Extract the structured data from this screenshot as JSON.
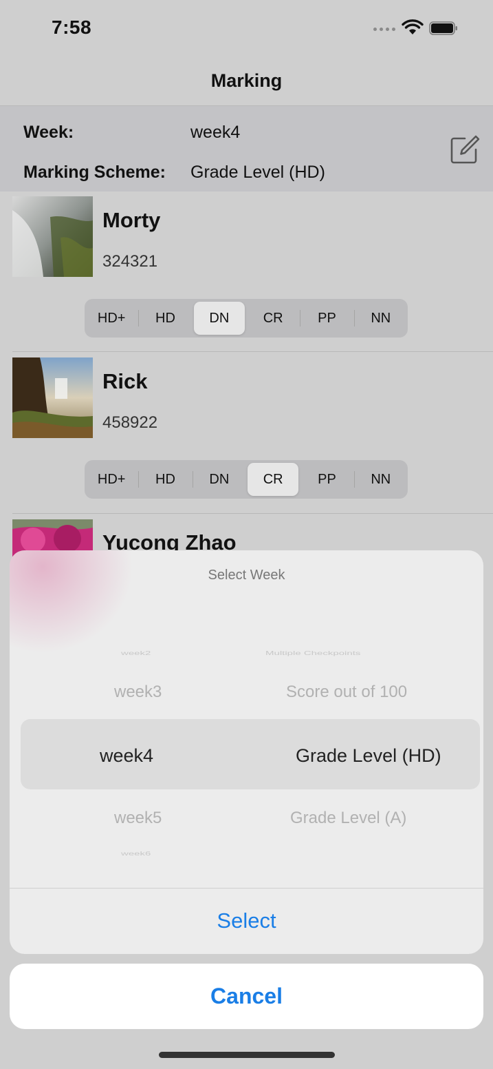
{
  "status_bar": {
    "time": "7:58"
  },
  "nav": {
    "title": "Marking"
  },
  "info": {
    "week_label": "Week:",
    "week_value": "week4",
    "scheme_label": "Marking Scheme:",
    "scheme_value": "Grade Level (HD)"
  },
  "grade_options": [
    "HD+",
    "HD",
    "DN",
    "CR",
    "PP",
    "NN"
  ],
  "students": [
    {
      "name": "Morty",
      "id": "324321",
      "selected_grade": "DN"
    },
    {
      "name": "Rick",
      "id": "458922",
      "selected_grade": "CR"
    },
    {
      "name": "Yucong Zhao"
    }
  ],
  "sheet": {
    "title": "Select Week",
    "weeks": [
      "week2",
      "week3",
      "week4",
      "week5",
      "week6"
    ],
    "schemes": [
      "Multiple Checkpoints",
      "Score out of 100",
      "Grade Level (HD)",
      "Grade Level (A)"
    ],
    "selected_week": "week4",
    "selected_scheme": "Grade Level (HD)",
    "select_label": "Select",
    "cancel_label": "Cancel"
  },
  "colors": {
    "accent": "#1a7ee6",
    "overlay": "#cfcfcf"
  }
}
